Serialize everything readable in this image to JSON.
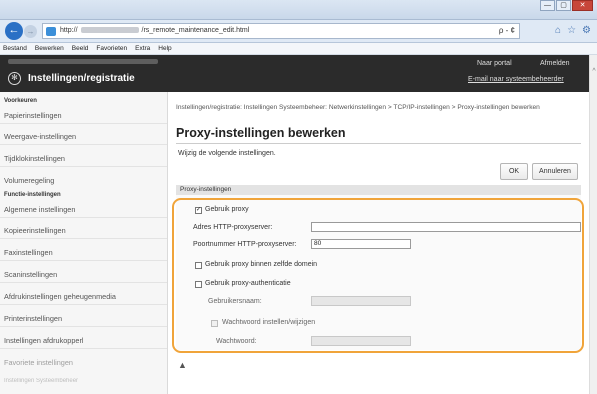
{
  "browser": {
    "url_prefix": "http://",
    "url_suffix": "/rs_remote_maintenance_edit.html",
    "url_tools": "ρ - ¢",
    "window_buttons": [
      "—",
      "▢",
      "✕"
    ],
    "menu": [
      "Bestand",
      "Bewerken",
      "Beeld",
      "Favorieten",
      "Extra",
      "Help"
    ]
  },
  "header": {
    "title": "Instellingen/registratie",
    "portal": "Naar portal",
    "logout": "Afmelden",
    "email": "E-mail naar systeembeheerder"
  },
  "sidebar": {
    "sections": [
      {
        "label": "Voorkeuren",
        "items": [
          "Papierinstellingen",
          "Weergave-instellingen",
          "Tijdklokinstellingen",
          "Volumeregeling"
        ]
      },
      {
        "label": "Functie-instellingen",
        "items": [
          "Algemene instellingen",
          "Kopieerinstellingen",
          "Faxinstellingen",
          "Scaninstellingen",
          "Afdrukinstellingen geheugenmedia",
          "Printerinstellingen",
          "Instellingen afdrukopperl",
          "Favoriete instellingen",
          "Instellingen Systeembeheer"
        ]
      }
    ]
  },
  "main": {
    "breadcrumb": "Instellingen/registratie: Instellingen Systeembeheer: Netwerkinstellingen > TCP/IP-instellingen > Proxy-instellingen bewerken",
    "title": "Proxy-instellingen bewerken",
    "instruction": "Wijzig de volgende instellingen.",
    "ok_label": "OK",
    "cancel_label": "Annuleren",
    "section_title": "Proxy-instellingen",
    "use_proxy_label": "Gebruik proxy",
    "use_proxy_checked": true,
    "http_address_label": "Adres HTTP-proxyserver:",
    "http_address_value": "",
    "port_label": "Poortnummer HTTP-proxyserver:",
    "port_value": "80",
    "same_domain_label": "Gebruik proxy binnen zelfde domein",
    "same_domain_checked": false,
    "auth_label": "Gebruik proxy-authenticatie",
    "auth_checked": false,
    "username_label": "Gebruikersnaam:",
    "username_value": "",
    "set_password_label": "Wachtwoord instellen/wijzigen",
    "password_label": "Wachtwoord:",
    "password_value": "",
    "top_link": "▲"
  },
  "colors": {
    "header_bg": "#2b2b2b",
    "highlight": "#f0a43a",
    "back_button": "#2a70c5"
  }
}
